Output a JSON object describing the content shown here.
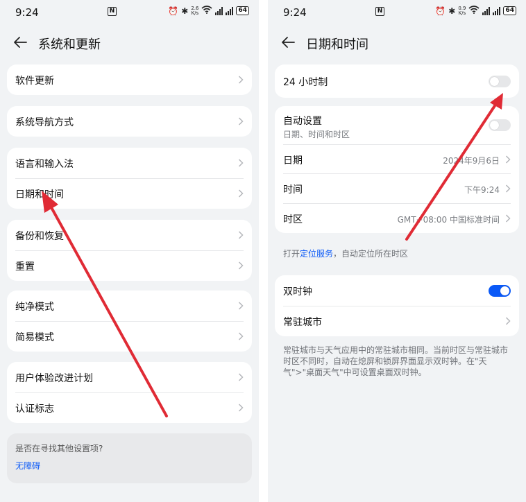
{
  "status_bar": {
    "time": "9:24",
    "nfc": "N",
    "left_speed_top": "2.6",
    "right_speed_top": "0.9",
    "speed_unit": "K/s",
    "battery": "64"
  },
  "left": {
    "title": "系统和更新",
    "groups": [
      [
        "软件更新"
      ],
      [
        "系统导航方式"
      ],
      [
        "语言和输入法",
        "日期和时间"
      ],
      [
        "备份和恢复",
        "重置"
      ],
      [
        "纯净模式",
        "简易模式"
      ],
      [
        "用户体验改进计划",
        "认证标志"
      ]
    ],
    "help": {
      "question": "是否在寻找其他设置项?",
      "link": "无障碍"
    }
  },
  "right": {
    "title": "日期和时间",
    "h24": {
      "label": "24 小时制",
      "on": false
    },
    "auto": {
      "label": "自动设置",
      "sub": "日期、时间和时区",
      "on": false
    },
    "date": {
      "label": "日期",
      "value": "2024年9月6日"
    },
    "time": {
      "label": "时间",
      "value": "下午9:24"
    },
    "timezone": {
      "label": "时区",
      "value": "GMT+08:00 中国标准时间"
    },
    "location_note": {
      "prefix": "打开",
      "link": "定位服务",
      "suffix": "，自动定位所在时区"
    },
    "dual_clock": {
      "label": "双时钟",
      "on": true
    },
    "home_city": {
      "label": "常驻城市"
    },
    "dual_note": "常驻城市与天气应用中的常驻城市相同。当前时区与常驻城市时区不同时，自动在熄屏和锁屏界面显示双时钟。在\"天气\">\"桌面天气\"中可设置桌面双时钟。"
  },
  "colors": {
    "accent": "#0a59f7",
    "annotation": "#e02b35",
    "background": "#f1f3f5"
  }
}
